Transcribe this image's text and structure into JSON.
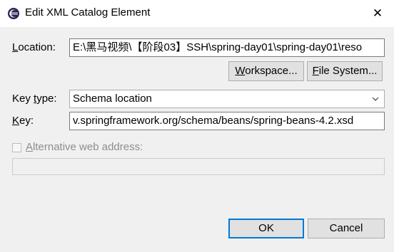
{
  "window": {
    "title": "Edit XML Catalog Element",
    "close_glyph": "✕"
  },
  "location": {
    "label_accel": "L",
    "label_rest": "ocation:",
    "value": "E:\\黑马视频\\【阶段03】SSH\\spring-day01\\spring-day01\\reso"
  },
  "buttons": {
    "workspace_accel": "W",
    "workspace_rest": "orkspace...",
    "filesystem_accel": "F",
    "filesystem_rest": "ile System...",
    "ok": "OK",
    "cancel": "Cancel"
  },
  "key_type": {
    "label_pre": "Key ",
    "label_accel": "t",
    "label_rest": "ype:",
    "selected": "Schema location"
  },
  "key": {
    "label_accel": "K",
    "label_rest": "ey:",
    "value": "v.springframework.org/schema/beans/spring-beans-4.2.xsd"
  },
  "alt_web": {
    "label_accel": "A",
    "label_rest": "lternative web address:",
    "checked": false,
    "value": ""
  },
  "colors": {
    "accent": "#0078d7",
    "window_bg": "#f0f0f0"
  }
}
